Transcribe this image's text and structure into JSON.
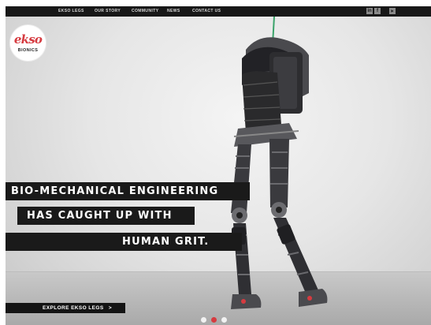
{
  "nav": {
    "items": [
      {
        "label": "EKSO LEGS"
      },
      {
        "label": "OUR STORY"
      },
      {
        "label": "COMMUNITY"
      },
      {
        "label": "NEWS"
      },
      {
        "label": "CONTACT US"
      }
    ],
    "social": [
      {
        "icon": "linkedin-icon",
        "glyph": "in"
      },
      {
        "icon": "facebook-icon",
        "glyph": "f"
      },
      {
        "icon": "youtube-icon",
        "glyph": "▶"
      }
    ]
  },
  "logo": {
    "script": "ekso",
    "sub": "BIONICS",
    "color": "#d63b40"
  },
  "hero": {
    "lines": [
      "BIO-MECHANICAL ENGINEERING",
      "HAS CAUGHT UP WITH",
      "HUMAN GRIT."
    ],
    "cta": "EXPLORE EKSO LEGS",
    "cta_arrow": ">"
  },
  "slider": {
    "active_index": 1,
    "dots": 3,
    "active_color": "#d63b40",
    "inactive_color": "#f2f2f2"
  }
}
